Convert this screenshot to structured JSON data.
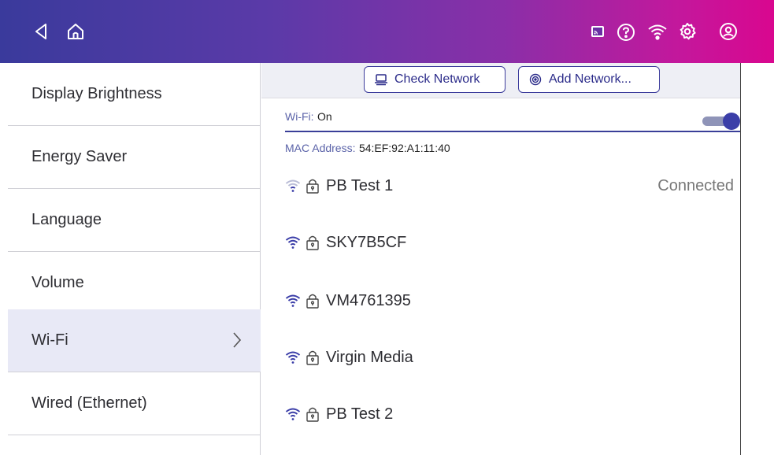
{
  "colors": {
    "accent": "#3b3ea8",
    "active_bg": "#e8e9f6"
  },
  "topbar": {
    "icons": [
      "back-icon",
      "home-icon",
      "cast-icon",
      "help-icon",
      "wifi-icon",
      "gear-icon",
      "account-icon"
    ]
  },
  "sidebar": {
    "items": [
      {
        "label": "Display Brightness"
      },
      {
        "label": "Energy Saver"
      },
      {
        "label": "Language"
      },
      {
        "label": "Volume"
      },
      {
        "label": "Wi-Fi",
        "active": true
      },
      {
        "label": "Wired (Ethernet)"
      }
    ]
  },
  "toolbar": {
    "check_network_label": "Check Network",
    "add_network_label": "Add Network..."
  },
  "wifi": {
    "label": "Wi-Fi:",
    "value": "On",
    "mac_label": "MAC Address:",
    "mac_value": "54:EF:92:A1:11:40"
  },
  "networks": [
    {
      "name": "PB Test 1",
      "status": "Connected",
      "signal": "weak"
    },
    {
      "name": "SKY7B5CF",
      "status": "",
      "signal": "full"
    },
    {
      "name": "VM4761395",
      "status": "",
      "signal": "full"
    },
    {
      "name": "Virgin Media",
      "status": "",
      "signal": "full"
    },
    {
      "name": "PB Test 2",
      "status": "",
      "signal": "full"
    }
  ]
}
